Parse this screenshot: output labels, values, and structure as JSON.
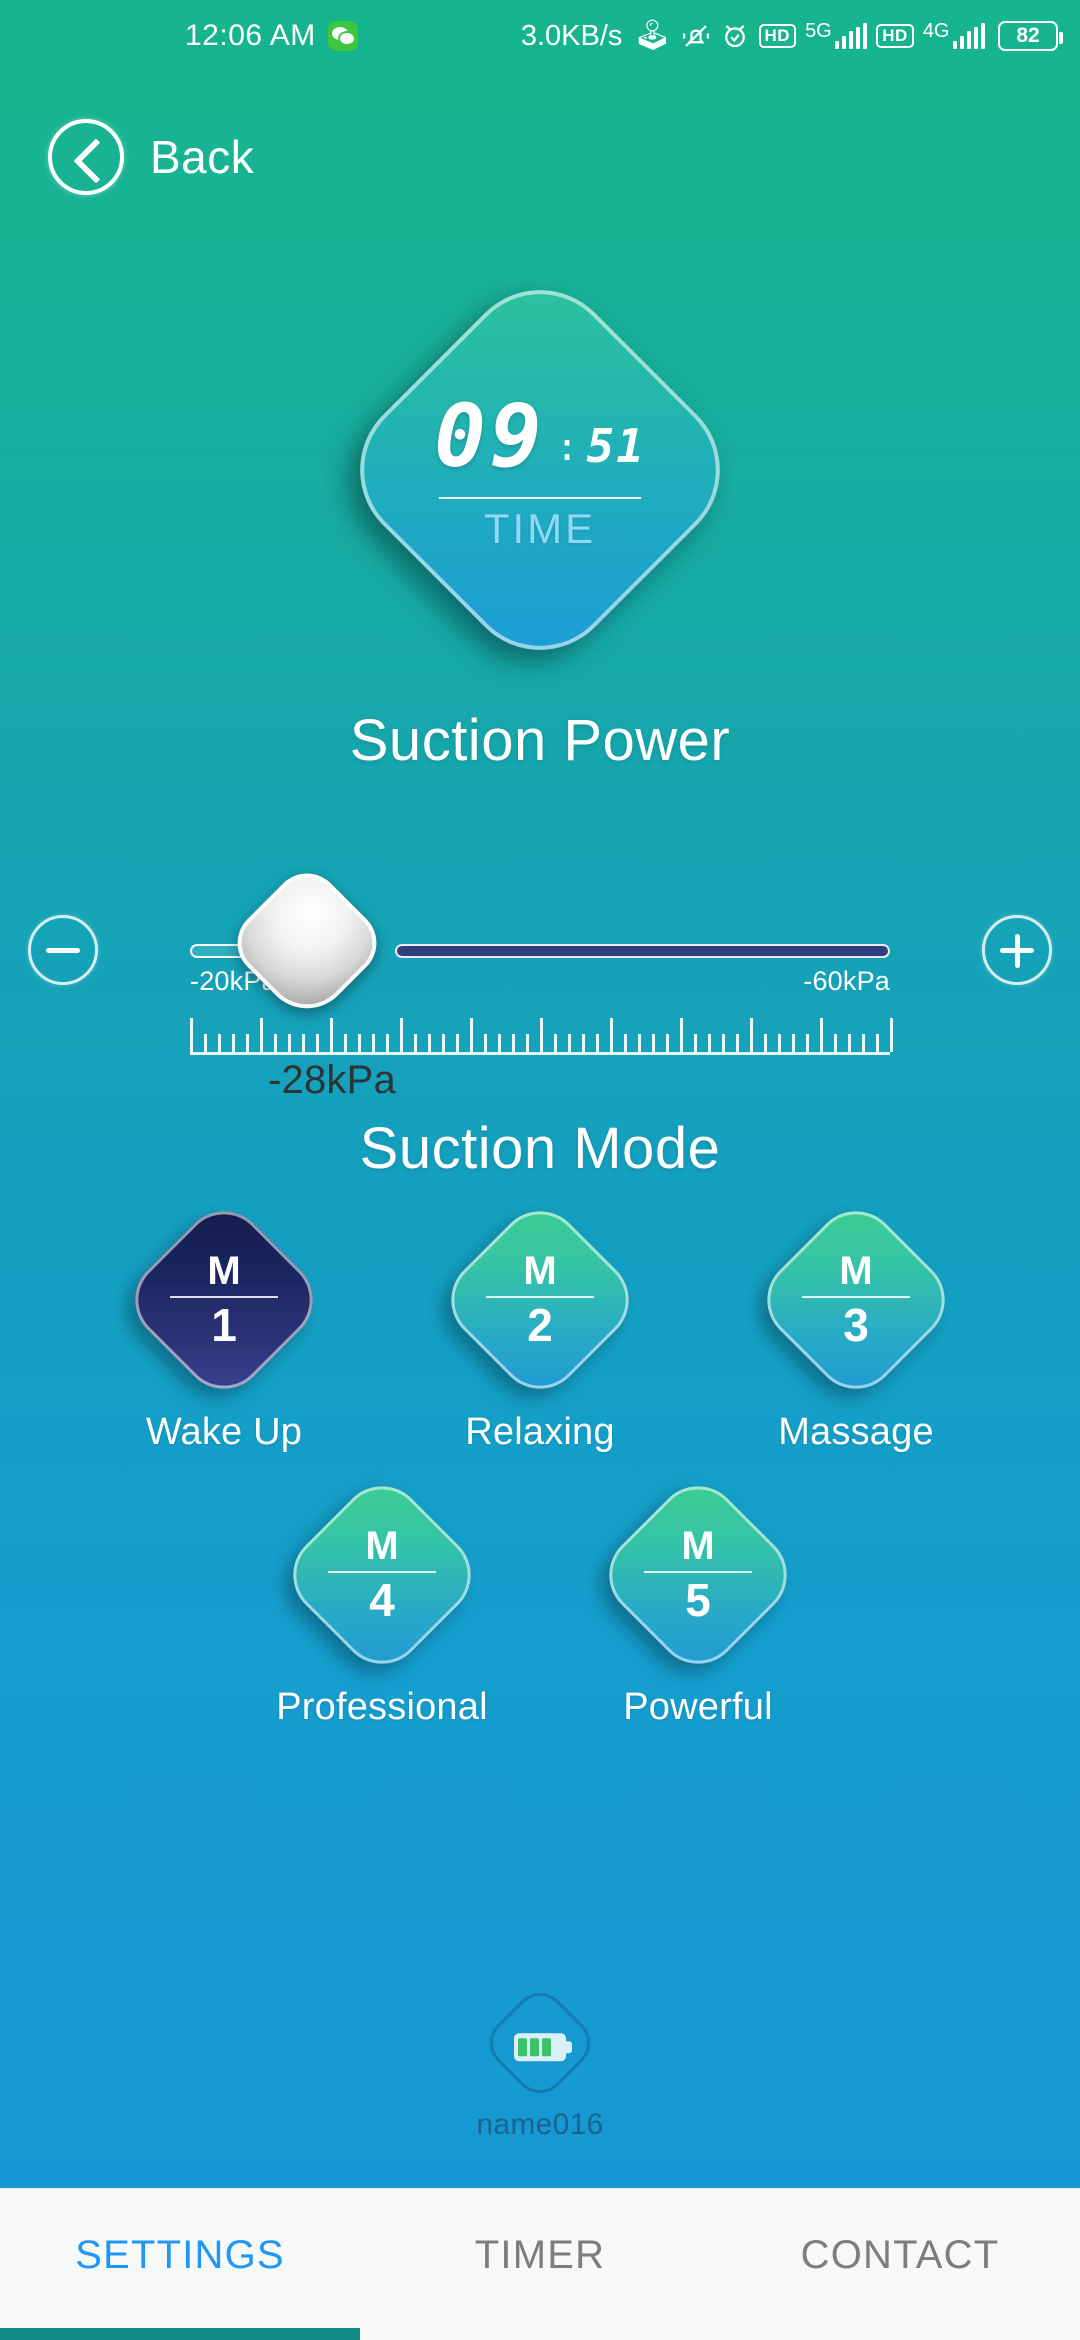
{
  "status_bar": {
    "time": "12:06 AM",
    "app_icon": "wechat-icon",
    "network_speed": "3.0KB/s",
    "bluetooth_icon": "bluetooth-icon",
    "mute_icon": "vibrate-mute-icon",
    "alarm_icon": "alarm-clock-icon",
    "hd_badge_1": "HD",
    "network_label_1": "5G",
    "hd_badge_2": "HD",
    "network_label_2": "4G",
    "battery_percent": "82"
  },
  "navbar": {
    "back_label": "Back",
    "back_icon": "chevron-left-circle-icon"
  },
  "timer": {
    "minutes": "09",
    "separator": ":",
    "seconds": "51",
    "caption": "TIME"
  },
  "suction_power": {
    "title": "Suction Power",
    "decrease_label": "minus",
    "increase_label": "plus",
    "min_label": "-20kPa",
    "max_label": "-60kPa",
    "current_value": "-28kPa",
    "min_value": -20,
    "max_value": -60,
    "value": -28,
    "track_filled_color": "#2d3f7c"
  },
  "suction_mode": {
    "title": "Suction Mode",
    "selected_index": 0,
    "modes": [
      {
        "badge": "M",
        "number": "1",
        "label": "Wake Up",
        "selected": true
      },
      {
        "badge": "M",
        "number": "2",
        "label": "Relaxing",
        "selected": false
      },
      {
        "badge": "M",
        "number": "3",
        "label": "Massage",
        "selected": false
      },
      {
        "badge": "M",
        "number": "4",
        "label": "Professional",
        "selected": false
      },
      {
        "badge": "M",
        "number": "5",
        "label": "Powerful",
        "selected": false
      }
    ]
  },
  "device": {
    "name": "name016",
    "battery_icon": "battery-level-icon",
    "battery_bars": 3
  },
  "tabs": [
    {
      "label": "SETTINGS",
      "active": true
    },
    {
      "label": "TIMER",
      "active": false
    },
    {
      "label": "CONTACT",
      "active": false
    }
  ],
  "colors": {
    "background_top": "#16b58d",
    "background_bottom": "#1795d6",
    "accent_active_tab": "#2196f3",
    "gesture_bar": "#128a84",
    "selected_mode": "#1d2560"
  }
}
